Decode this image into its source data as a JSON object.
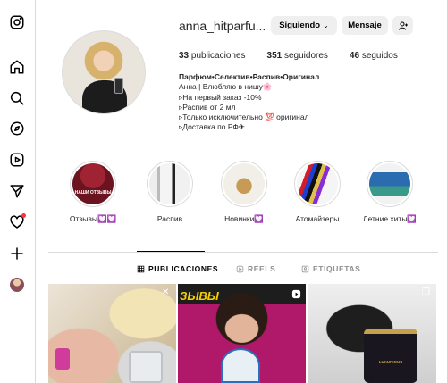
{
  "profile": {
    "username": "anna_hitparfu...",
    "follow_button": "Siguiendo",
    "message_button": "Mensaje",
    "stats": {
      "posts_count": "33",
      "posts_label": "publicaciones",
      "followers_count": "351",
      "followers_label": "seguidores",
      "following_count": "46",
      "following_label": "seguidos"
    },
    "bio": {
      "line1": "Парфюм•Селектив•Распив•Оригинал",
      "line2": "Анна | Влюбляю в нишу🌸",
      "line3": "▹На первый заказ -10%",
      "line4": "▹Распив от 2 мл",
      "line5": "▹Только исключительно 💯 оригинал",
      "line6": "▹Доставка по РФ✈"
    }
  },
  "highlights": [
    {
      "label": "Отзывы💟💟",
      "inner_text": "НАШИ ОТЗЫВЫ"
    },
    {
      "label": "Распив"
    },
    {
      "label": "Новинки💟"
    },
    {
      "label": "Атомайзеры"
    },
    {
      "label": "Летние хиты💟"
    }
  ],
  "tabs": [
    {
      "label": "PUBLICACIONES",
      "active": true
    },
    {
      "label": "REELS",
      "active": false
    },
    {
      "label": "ETIQUETAS",
      "active": false
    }
  ],
  "posts": [
    {
      "caption": ""
    },
    {
      "caption": "ЗЫВЫ"
    },
    {
      "caption": "LUXURIOUS"
    }
  ],
  "icons": {
    "logo": "instagram-icon",
    "home": "home-icon",
    "search": "search-icon",
    "explore": "compass-icon",
    "reels": "reels-icon",
    "messages": "send-icon",
    "notifications": "heart-icon",
    "create": "plus-icon"
  },
  "colors": {
    "notification_dot": "#ff3040",
    "button_bg": "#efefef",
    "border": "#dbdbdb"
  }
}
